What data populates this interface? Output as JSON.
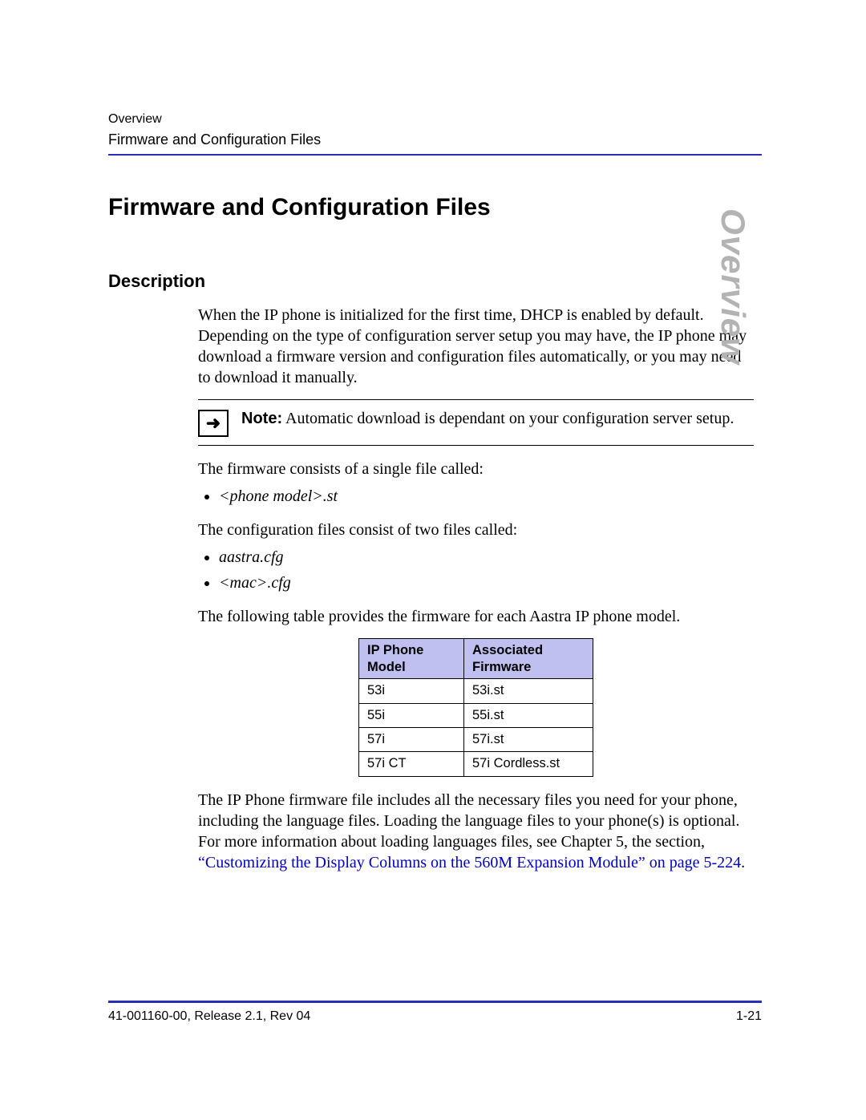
{
  "header": {
    "section": "Overview",
    "topic": "Firmware and Configuration Files"
  },
  "side_tab": "Overview",
  "title": "Firmware and Configuration Files",
  "subhead": "Description",
  "body": {
    "intro": "When the IP phone is initialized for the first time, DHCP is enabled by default. Depending on the type of configuration server setup you may have, the IP phone may download a firmware version and configuration files automatically, or you may need to download it manually.",
    "note_label": "Note:",
    "note_text": " Automatic download is dependant on your configuration server setup.",
    "firmware_line": "The firmware consists of a single file called:",
    "firmware_items": [
      "<phone model>.st"
    ],
    "config_line": "The configuration files consist of two files called:",
    "config_items": [
      "aastra.cfg",
      "<mac>.cfg"
    ],
    "table_intro": "The following table provides the firmware for each Aastra IP phone model.",
    "para_after_prefix": "The IP Phone firmware file includes all the necessary files you need for your phone, including the language files. Loading the language files to your phone(s) is optional. For more information about loading languages files, see Chapter 5, the section, ",
    "link_text": "“Customizing the Display Columns on the 560M Expansion Module” on page 5-224",
    "para_after_suffix": "."
  },
  "table": {
    "head_model": "IP Phone Model",
    "head_fw": "Associated Firmware",
    "rows": [
      {
        "model": "53i",
        "fw": "53i.st"
      },
      {
        "model": "55i",
        "fw": "55i.st"
      },
      {
        "model": "57i",
        "fw": "57i.st"
      },
      {
        "model": "57i CT",
        "fw": "57i Cordless.st"
      }
    ]
  },
  "footer": {
    "left": "41-001160-00, Release 2.1, Rev 04",
    "right": "1-21"
  }
}
